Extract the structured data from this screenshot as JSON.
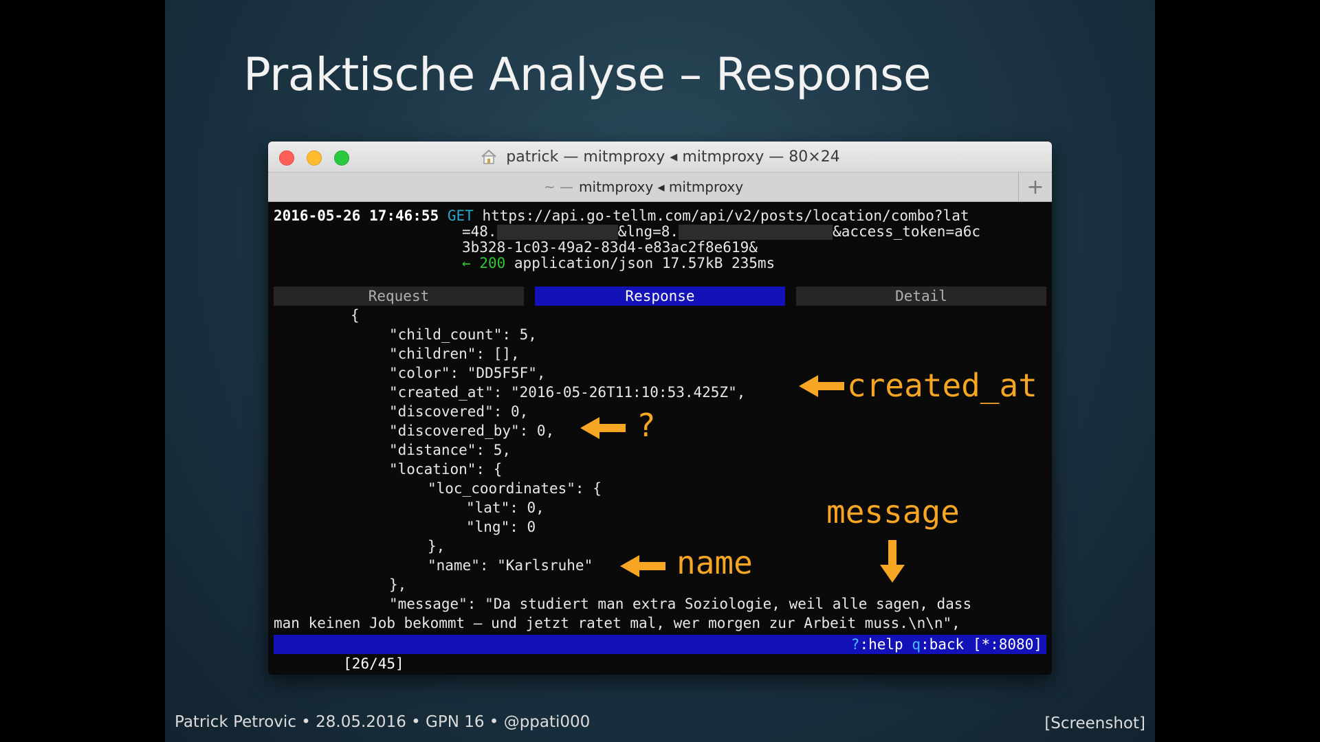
{
  "slide": {
    "title": "Praktische Analyse – Response",
    "footer": "Patrick Petrovic • 28.05.2016 • GPN 16 • @ppati000",
    "tag": "[Screenshot]"
  },
  "window": {
    "title": "patrick — mitmproxy ◂ mitmproxy — 80×24",
    "tab_prefix": "~ —",
    "tab_title": "mitmproxy ◂ mitmproxy",
    "new_tab_label": "+"
  },
  "flow": {
    "timestamp": "2016-05-26 17:46:55",
    "method": "GET",
    "url_line1": "https://api.go-tellm.com/api/v2/posts/location/combo?lat",
    "url_line2_a": "=48.",
    "url_line2_b": "&lng=8.",
    "url_line2_c": "&access_token=a6c",
    "url_line3": "3b328-1c03-49a2-83d4-e83ac2f8e619&",
    "resp_arrow": "←",
    "status": "200",
    "resp_info": "application/json 17.57kB 235ms"
  },
  "tabs": [
    "Request",
    "Response",
    "Detail"
  ],
  "body_lines": [
    "{",
    "\"child_count\": 5,",
    "\"children\": [],",
    "\"color\": \"DD5F5F\",",
    "\"created_at\": \"2016-05-26T11:10:53.425Z\",",
    "\"discovered\": 0,",
    "\"discovered_by\": 0,",
    "\"distance\": 5,",
    "\"location\": {",
    "\"loc_coordinates\": {",
    "\"lat\": 0,",
    "\"lng\": 0",
    "},",
    "\"name\": \"Karlsruhe\"",
    "},",
    "\"message\": \"Da studiert man extra Soziologie, weil alle sagen, dass",
    "man keinen Job bekommt – und jetzt ratet mal, wer morgen zur Arbeit muss.\\n\\n\","
  ],
  "statusbar": {
    "position": "[26/45]",
    "help_key": "?",
    "help_label": ":help",
    "back_key": "q",
    "back_label": ":back",
    "port": "[*:8080]"
  },
  "annotations": {
    "created_at": "created_at",
    "question": "?",
    "message": "message",
    "name": "name"
  },
  "colors": {
    "annotation": "#f6a623",
    "active_tab": "#1212b8",
    "status_ok": "#34c734",
    "method": "#2aa8c8"
  }
}
